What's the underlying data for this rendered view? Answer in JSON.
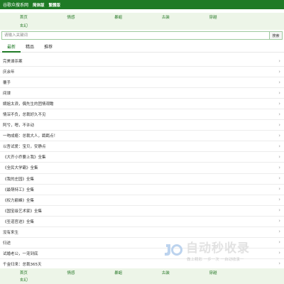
{
  "header": {
    "site_name": "谷歌众搜系网",
    "version_links": [
      "简体版",
      "繁體版"
    ]
  },
  "nav": {
    "rows": [
      [
        "首页",
        "情感",
        "暴蛆",
        "古装",
        "穿越"
      ],
      [
        "玄幻"
      ]
    ]
  },
  "search": {
    "placeholder": "请输入关键词",
    "button_label": "搜索"
  },
  "tabs": [
    {
      "label": "最新",
      "active": true
    },
    {
      "label": "精品",
      "active": false
    },
    {
      "label": "推荐",
      "active": false
    }
  ],
  "list": [
    {
      "title": "完美谍杀案"
    },
    {
      "title": "庆余年"
    },
    {
      "title": "覆手"
    },
    {
      "title": "间谍"
    },
    {
      "title": "嫡姐太浪，偶先生的团情观瞻"
    },
    {
      "title": "情深不负，总裁好久不见"
    },
    {
      "title": "阿兮，嗯，不许动"
    },
    {
      "title": "一吻成瘾：总裁大人，羁羁点！"
    },
    {
      "title": "以吾试爱：宝贝，安静点"
    },
    {
      "title": "《大齐小乔要上我》全集"
    },
    {
      "title": "《全民大学霸》全集"
    },
    {
      "title": "《我的庄园》全集"
    },
    {
      "title": "《最萌特工》全集"
    },
    {
      "title": "《权力巅峰》全集"
    },
    {
      "title": "《国宝级艺术家》全集"
    },
    {
      "title": "《圣道官途》全集"
    },
    {
      "title": "没有来生"
    },
    {
      "title": "归途"
    },
    {
      "title": "试婚老公，一宠到底"
    },
    {
      "title": "千金归来：总裁365天"
    }
  ],
  "watermark": {
    "main_text": "自动秒收录",
    "sub_text": "做上精彩 一步一次 一自动收录一"
  },
  "colors": {
    "brand_green": "#1f7a26",
    "nav_bg": "#edf5e8",
    "watermark_blue": "#bcd3ee"
  }
}
